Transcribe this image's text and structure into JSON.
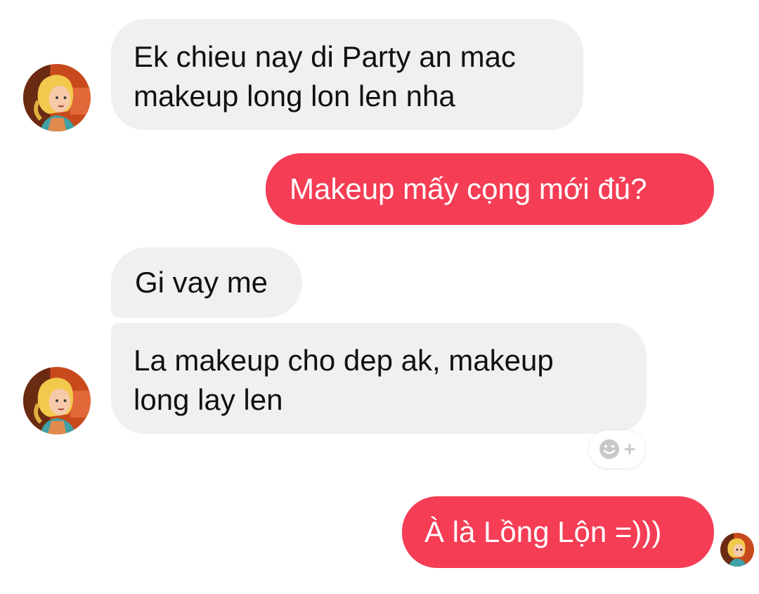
{
  "conversation": {
    "messages": [
      {
        "direction": "incoming",
        "text": "Ek chieu nay di Party an mac\nmakeup long lon len nha"
      },
      {
        "direction": "outgoing",
        "text": "Makeup mấy cọng mới đủ?"
      },
      {
        "direction": "incoming",
        "text": "Gi vay me"
      },
      {
        "direction": "incoming",
        "text": "La makeup cho dep ak, makeup\nlong lay len"
      },
      {
        "direction": "outgoing",
        "text": "À là Lồng Lộn =)))"
      }
    ],
    "reaction_button_icon": "add-reaction-smiley-icon",
    "avatar_icon": "cartoon-blonde-girl-avatar"
  },
  "colors": {
    "incoming_bubble": "#f1f0f0",
    "outgoing_bubble": "#f53d55",
    "outgoing_text": "#ffffff"
  }
}
